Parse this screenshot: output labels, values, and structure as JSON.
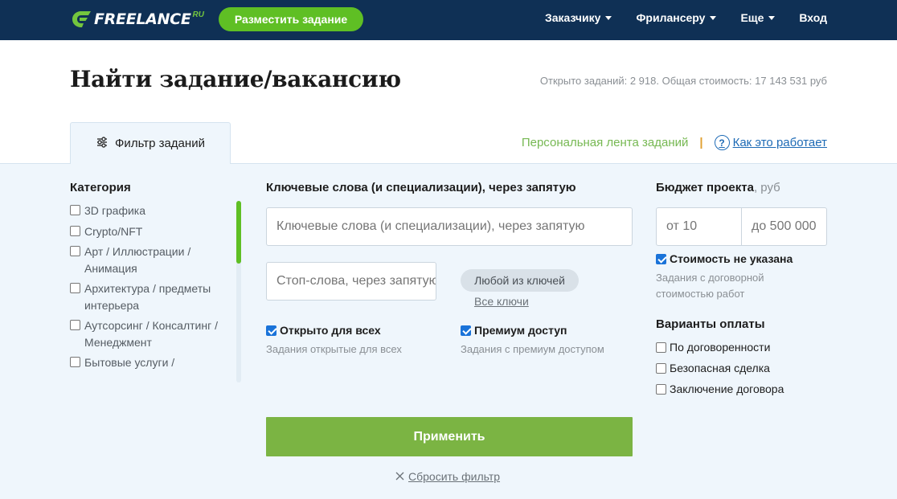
{
  "header": {
    "logo_text": "FREELANCE",
    "logo_suffix": "RU",
    "post_button": "Разместить задание",
    "nav": [
      {
        "label": "Заказчику",
        "has_caret": true
      },
      {
        "label": "Фрилансеру",
        "has_caret": true
      },
      {
        "label": "Еще",
        "has_caret": true
      },
      {
        "label": "Вход",
        "has_caret": false
      }
    ]
  },
  "page": {
    "title": "Найти задание/вакансию",
    "stats": "Открыто заданий: 2 918. Общая стоимость: 17 143 531 руб"
  },
  "tabs": {
    "filter_tab": "Фильтр заданий",
    "filter_icon": "sliders-icon",
    "personal_feed": "Персональная лента заданий",
    "separator": "|",
    "how_it_works": "Как это работает",
    "how_icon": "question-circle-icon"
  },
  "filters": {
    "category": {
      "label": "Категория",
      "items": [
        {
          "label": "3D графика",
          "checked": false
        },
        {
          "label": "Crypto/NFT",
          "checked": false
        },
        {
          "label": "Арт / Иллюстрации / Анимация",
          "checked": false
        },
        {
          "label": "Архитектура / предметы интерьера",
          "checked": false
        },
        {
          "label": "Аутсорсинг / Консалтинг / Менеджмент",
          "checked": false
        },
        {
          "label": "Бытовые услуги /",
          "checked": false
        }
      ]
    },
    "keywords": {
      "label": "Ключевые слова (и специализации), через запятую",
      "placeholder": "Ключевые слова (и специализации), через запятую",
      "value": ""
    },
    "stopwords": {
      "placeholder": "Стоп-слова, через запятую",
      "value": ""
    },
    "match_mode": "Любой из ключей",
    "all_keys_link": "Все ключи",
    "open_for_all": {
      "label": "Открыто для всех",
      "hint": "Задания открытые для всех",
      "checked": true
    },
    "premium": {
      "label": "Премиум доступ",
      "hint": "Задания с премиум доступом",
      "checked": true
    },
    "budget": {
      "label": "Бюджет проекта",
      "unit": ", руб",
      "from_placeholder": "от 10",
      "to_placeholder": "до 500 000",
      "not_specified": {
        "label": "Стоимость не указана",
        "checked": true
      },
      "hint_line1": "Задания с договорной",
      "hint_line2": "стоимостью работ"
    },
    "payment": {
      "label": "Варианты оплаты",
      "options": [
        {
          "label": "По договоренности",
          "checked": false
        },
        {
          "label": "Безопасная сделка",
          "checked": false
        },
        {
          "label": "Заключение договора",
          "checked": false
        }
      ]
    },
    "apply_button": "Применить",
    "reset_link": "Сбросить фильтр",
    "reset_icon": "close-icon"
  },
  "colors": {
    "header_bg": "#0f3055",
    "brand_green": "#5fbf24",
    "apply_green": "#7bb443",
    "panel_bg": "#eff6fc",
    "link_blue": "#1d6ab5",
    "checkbox_blue": "#1a73d9"
  }
}
